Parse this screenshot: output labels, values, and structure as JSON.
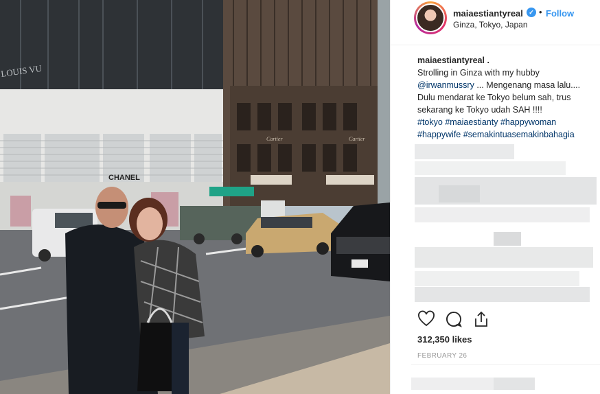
{
  "post": {
    "username": "maiaestiantyreal",
    "verified_icon": "verified-badge-icon",
    "separator": "•",
    "follow_label": "Follow",
    "location": "Ginza, Tokyo, Japan",
    "caption": {
      "user": "maiaestiantyreal .",
      "line1": "Strolling in Ginza with my hubby",
      "mention": "@irwanmussry",
      "line2": " ... Mengenang masa lalu....",
      "line3": "Dulu mendarat ke Tokyo belum sah, trus sekarang ke Tokyo udah SAH !!!!",
      "hashtags": [
        "#tokyo",
        "#maiaestianty",
        "#happywoman",
        "#happywife",
        "#semakintuasemakinbahagia"
      ]
    },
    "likes": "312,350 likes",
    "date": "FEBRUARY 26"
  },
  "photo": {
    "store_sign_chanel": "CHANEL",
    "store_sign_cartier": "Cartier",
    "store_sign_louis": "LOUIS VU"
  },
  "icons": {
    "like": "heart-icon",
    "comment": "comment-icon",
    "share": "share-icon"
  },
  "colors": {
    "link_blue": "#3897f0",
    "hashtag": "#003569",
    "text": "#262626",
    "muted": "#999999"
  }
}
